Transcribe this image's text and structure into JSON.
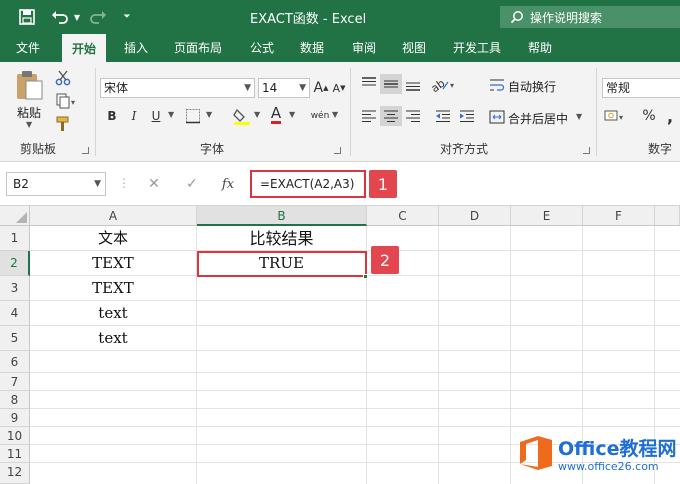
{
  "titlebar": {
    "title": "EXACT函数  -  Excel",
    "search_label": "操作说明搜索",
    "icons": [
      "save-icon",
      "undo-icon",
      "redo-icon",
      "customize-qat-icon",
      "search-icon"
    ]
  },
  "menu": {
    "tabs": [
      "文件",
      "开始",
      "插入",
      "页面布局",
      "公式",
      "数据",
      "审阅",
      "视图",
      "开发工具",
      "帮助"
    ],
    "active_tab": "开始"
  },
  "ribbon": {
    "clipboard": {
      "paste_label": "粘贴",
      "group_label": "剪贴板"
    },
    "font": {
      "font_name": "宋体",
      "font_size": "14",
      "bold": "B",
      "italic": "I",
      "underline": "U",
      "font_color_glyph": "A",
      "phonetic_glyph": "wén",
      "group_label": "字体"
    },
    "alignment": {
      "wrap_text": "自动换行",
      "merge_center": "合并后居中",
      "group_label": "对齐方式"
    },
    "number": {
      "format": "常规",
      "percent": "%",
      "comma": ",",
      "group_label": "数字"
    }
  },
  "formula_bar": {
    "name_box": "B2",
    "fx_label": "fx",
    "formula": "=EXACT(A2,A3)",
    "badge": "1"
  },
  "sheet": {
    "columns": [
      "A",
      "B",
      "C",
      "D",
      "E",
      "F"
    ],
    "rows": [
      "1",
      "2",
      "3",
      "4",
      "5",
      "6",
      "7",
      "8",
      "9",
      "10",
      "11",
      "12"
    ],
    "active_cell": "B2",
    "cells": {
      "A1": "文本",
      "B1": "比较结果",
      "A2": "TEXT",
      "B2": "TRUE",
      "A3": "TEXT",
      "A4": "text",
      "A5": "text"
    },
    "badge": "2"
  },
  "watermark": {
    "brand": "Office教程网",
    "url": "www.office26.com"
  },
  "colors": {
    "excel_green": "#217346",
    "annotation_red": "#d9363e",
    "watermark_blue": "#1f6ed4",
    "watermark_orange": "#f06a1d"
  }
}
